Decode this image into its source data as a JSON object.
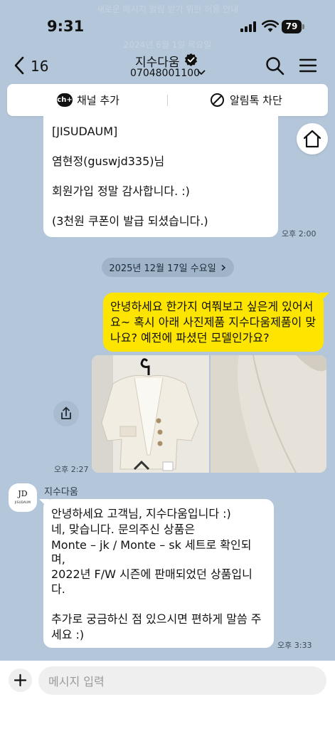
{
  "status_bar": {
    "time": "9:31",
    "battery": "79"
  },
  "ghost": {
    "top_notice": "새로운 메시지 알림 받기 위한 허용 안내",
    "top_date": "2024년 6월 1일 목요일"
  },
  "header": {
    "back_count": "16",
    "title": "지수다움",
    "phone": "07048001100"
  },
  "channel_bar": {
    "add_label": "채널 추가",
    "block_label": "알림톡 차단"
  },
  "messages": {
    "welcome": {
      "line1": "[JISUDAUM]",
      "line2": "염현정(guswjd335)님",
      "line3": "회원가입 정말 감사합니다. :)",
      "line4": "(3천원 쿠폰이 발급 되셨습니다.)",
      "time": "오후 2:00"
    },
    "date_divider": "2025년 12월 17일 수요일",
    "question": {
      "line1": "안녕하세요 한가지 여쭤보고 싶은게 있어서",
      "line2": "요~ 혹시 아래 사진제품 지수다움제품이 맞",
      "line3": "나요? 예전에 파셨던 모델인가요?"
    },
    "photos_time": "오후 2:27",
    "reply": {
      "sender": "지수다움",
      "line1": "안녕하세요 고객님, 지수다움입니다 :)",
      "line2": "네, 맞습니다. 문의주신 상품은",
      "line3": "Monte – jk / Monte – sk 세트로 확인되",
      "line4": "며,",
      "line5": "2022년 F/W 시즌에 판매되었던 상품입니",
      "line6": "다.",
      "line7": "추가로 궁금하신 점 있으시면 편하게 말씀 주",
      "line8": "세요 :)",
      "time": "오후 3:33"
    }
  },
  "avatar": {
    "logo_text": "JD",
    "brand_text": "JISUDAUM"
  },
  "composer": {
    "placeholder": "메시지 입력"
  },
  "colors": {
    "background": "#b4c6d9",
    "my_bubble": "#fee500",
    "their_bubble": "#ffffff"
  }
}
